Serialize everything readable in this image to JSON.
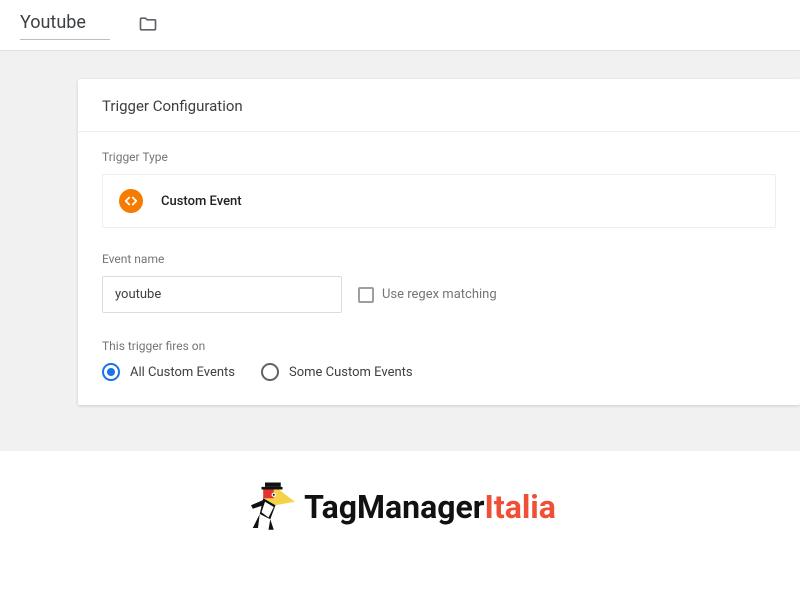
{
  "topbar": {
    "tag_name": "Youtube"
  },
  "panel": {
    "title": "Trigger Configuration",
    "type_label": "Trigger Type",
    "type_name": "Custom Event",
    "event_label": "Event name",
    "event_value": "youtube",
    "regex_label": "Use regex matching",
    "fires_label": "This trigger fires on",
    "radio_all": "All Custom Events",
    "radio_some": "Some Custom Events"
  },
  "brand": {
    "part1": "TagManager",
    "part2": "Italia"
  }
}
